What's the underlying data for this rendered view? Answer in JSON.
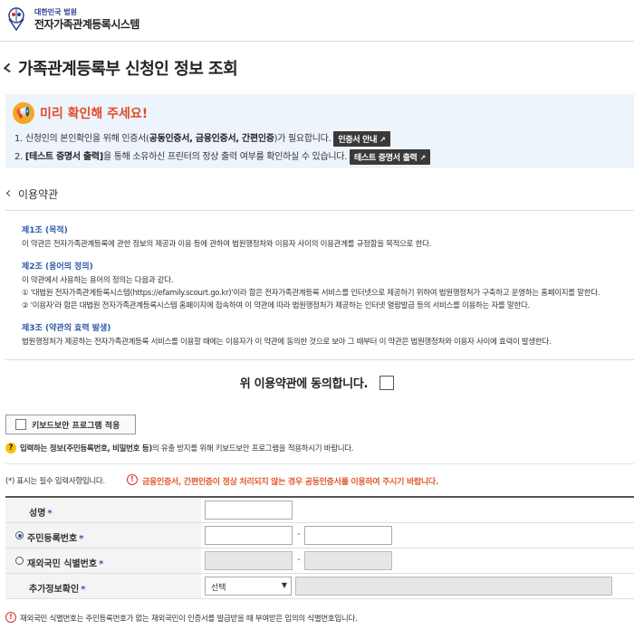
{
  "header": {
    "logo_small": "대한민국 법원",
    "logo_big": "전자가족관계등록시스템"
  },
  "page_title": "가족관계등록부 신청인 정보 조회",
  "notice": {
    "title": "미리 확인해 주세요!",
    "line1_a": "1. 신청인의 본인확인을 위해 인증서(",
    "line1_b": "공동인증서, 금융인증서, 간편인증",
    "line1_c": ")가 필요합니다.",
    "line1_button": "인증서 안내",
    "line2_a": "2. ",
    "line2_b": "[테스트 증명서 출력]",
    "line2_c": "을 통해 소유하신 프린터의 정상 출력 여부를 확인하실 수 있습니다.",
    "line2_button": "테스트 증명서 출력"
  },
  "terms": {
    "section_title": "이용약관",
    "articles": [
      {
        "title": "제1조 (목적)",
        "lines": [
          "이 약관은 전자가족관계등록에 관한 정보의 제공과 이용 등에 관하여 법원행정처와 이용자 사이의 이용관계를 규정함을 목적으로 한다."
        ]
      },
      {
        "title": "제2조 (용어의 정의)",
        "lines": [
          "이 약관에서 사용하는 용어의 정의는 다음과 같다.",
          "① '대법원 전자가족관계등록시스템(https://efamily.scourt.go.kr)'이라 함은 전자가족관계등록 서비스를 인터넷으로 제공하기 위하여 법원행정처가 구축하고 운영하는 홈페이지를 말한다.",
          "② '이용자'라 함은 대법원 전자가족관계등록시스템 홈페이지에 접속하여 이 약관에 따라 법원행정처가 제공하는 인터넷 열람발급 등의 서비스를 이용하는 자를 말한다."
        ]
      },
      {
        "title": "제3조 (약관의 효력 발생)",
        "lines": [
          "법원행정처가 제공하는 전자가족관계등록 서비스를 이용할 때에는 이용자가 이 약관에 동의한 것으로 보아 그 때부터 이 약관은 법원행정처와 이용자 사이에 효력이 발생한다."
        ]
      }
    ],
    "agree_label": "위 이용약관에 동의합니다."
  },
  "keyboard": {
    "button_label": "키보드보안 프로그램 적용",
    "hint_a": "입력하는 정보",
    "hint_b": "(주민등록번호, 비밀번호 등)",
    "hint_c": "의 유출 방지를 위해 키보드보안 프로그램을 적용하시기 바랍니다."
  },
  "form": {
    "required_note": "(*) 표시는 필수 입력사항입니다.",
    "warning": "금융인증서, 간편인증이 정상 처리되지 않는 경우 공동인증서를 이용하여 주시기 바랍니다.",
    "name_label": "성명",
    "resident_label": "주민등록번호",
    "foreigner_label": "재외국민 식별번호",
    "extra_label": "추가정보확인",
    "required_mark": "*",
    "dash": "-",
    "select_value": "선택",
    "footnote": "재외국민 식별번호는 주민등록번호가 없는 재외국민이 인증서를 발급받을 때 부여받은 임의의 식별번호입니다."
  }
}
